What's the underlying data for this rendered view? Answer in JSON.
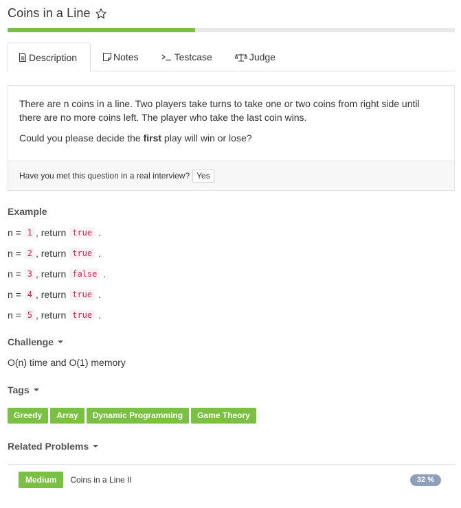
{
  "problem": {
    "title": "Coins in a Line",
    "progress_percent": 42
  },
  "tabs": [
    {
      "label": "Description",
      "icon": "document-icon",
      "active": true
    },
    {
      "label": "Notes",
      "icon": "note-icon",
      "active": false
    },
    {
      "label": "Testcase",
      "icon": "terminal-icon",
      "active": false
    },
    {
      "label": "Judge",
      "icon": "scale-icon",
      "active": false
    }
  ],
  "description": {
    "paragraph1": "There are n coins in a line. Two players take turns to take one or two coins from right side until there are no more coins left. The player who take the last coin wins.",
    "paragraph2_before": "Could you please decide the ",
    "paragraph2_bold": "first",
    "paragraph2_after": " play will win or lose?",
    "interview_question": "Have you met this question in a real interview?",
    "yes_label": "Yes"
  },
  "example": {
    "heading": "Example",
    "prefix": "n = ",
    "middle": ", return ",
    "suffix": ".",
    "lines": [
      {
        "n": "1",
        "result": "true"
      },
      {
        "n": "2",
        "result": "true"
      },
      {
        "n": "3",
        "result": "false"
      },
      {
        "n": "4",
        "result": "true"
      },
      {
        "n": "5",
        "result": "true"
      }
    ]
  },
  "challenge": {
    "heading": "Challenge",
    "text": "O(n) time and O(1) memory"
  },
  "tags": {
    "heading": "Tags",
    "items": [
      "Greedy",
      "Array",
      "Dynamic Programming",
      "Game Theory"
    ]
  },
  "related": {
    "heading": "Related Problems",
    "items": [
      {
        "difficulty": "Medium",
        "title": "Coins in a Line II",
        "rate": "32 %"
      }
    ]
  },
  "colors": {
    "accent_green": "#7ac143",
    "rate_badge": "#8f9fba",
    "code_text": "#c7254e"
  }
}
